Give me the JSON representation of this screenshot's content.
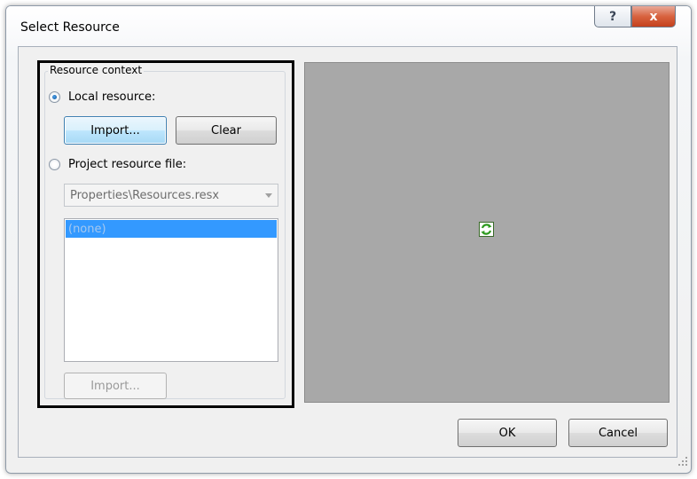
{
  "window": {
    "title": "Select Resource",
    "help_glyph": "?",
    "close_glyph": "x"
  },
  "resource_context": {
    "group_title": "Resource context",
    "local_resource_label": "Local resource:",
    "local_resource_checked": true,
    "import_label": "Import...",
    "clear_label": "Clear",
    "project_resource_label": "Project resource file:",
    "project_resource_checked": false,
    "resource_file_value": "Properties\\Resources.resx",
    "list_items": [
      "(none)"
    ],
    "project_import_label": "Import..."
  },
  "preview": {
    "icon": "refresh-icon"
  },
  "footer": {
    "ok_label": "OK",
    "cancel_label": "Cancel"
  },
  "colors": {
    "selection": "#3399ff",
    "preview_bg": "#a8a8a8",
    "close_button": "#c4401c"
  }
}
